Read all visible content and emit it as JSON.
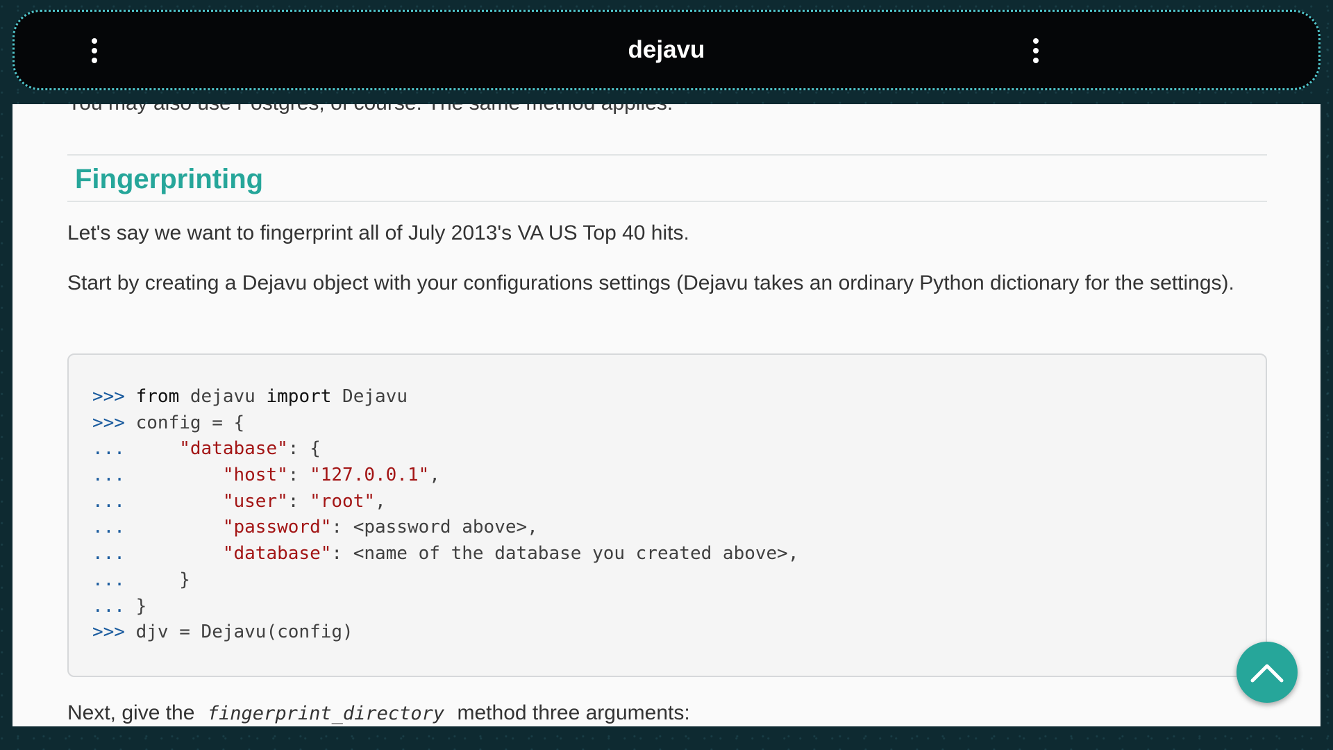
{
  "app": {
    "title": "dejavu"
  },
  "page": {
    "cut_text": "You may also use Postgres, of course. The same method applies.",
    "section_title": "Fingerprinting",
    "paragraph1": "Let's say we want to fingerprint all of July 2013's VA US Top 40 hits.",
    "paragraph2": "Start by creating a Dejavu object with your configurations settings (Dejavu takes an ordinary Python dictionary for the settings).",
    "paragraph3_before": "Next, give the",
    "paragraph3_code": "fingerprint_directory",
    "paragraph3_after": "method three arguments:"
  },
  "code": {
    "l1_prompt": ">>> ",
    "l1_kw1": "from",
    "l1_t1": " dejavu ",
    "l1_kw2": "import",
    "l1_t2": " Dejavu",
    "l2_prompt": ">>> ",
    "l2_t": "config = {",
    "l3_prompt": "...     ",
    "l3_s": "\"database\"",
    "l3_t": ": {",
    "l4_prompt": "...         ",
    "l4_s1": "\"host\"",
    "l4_t1": ": ",
    "l4_s2": "\"127.0.0.1\"",
    "l4_t2": ",",
    "l5_prompt": "...         ",
    "l5_s1": "\"user\"",
    "l5_t1": ": ",
    "l5_s2": "\"root\"",
    "l5_t2": ",",
    "l6_prompt": "...         ",
    "l6_s": "\"password\"",
    "l6_t": ": <password above>,",
    "l7_prompt": "...         ",
    "l7_s": "\"database\"",
    "l7_t": ": <name of the database you created above>,",
    "l8_prompt": "...     ",
    "l8_t": "}",
    "l9_prompt": "... ",
    "l9_t": "}",
    "l10_prompt": ">>> ",
    "l10_t": "djv = Dejavu(config)"
  },
  "icons": {
    "menu_left": "more-vertical-icon",
    "menu_right": "more-vertical-icon",
    "fab": "chevron-up-icon"
  },
  "colors": {
    "accent": "#26a69a",
    "topbar": "#050608",
    "string": "#a31515",
    "prompt": "#1a5b9e"
  }
}
